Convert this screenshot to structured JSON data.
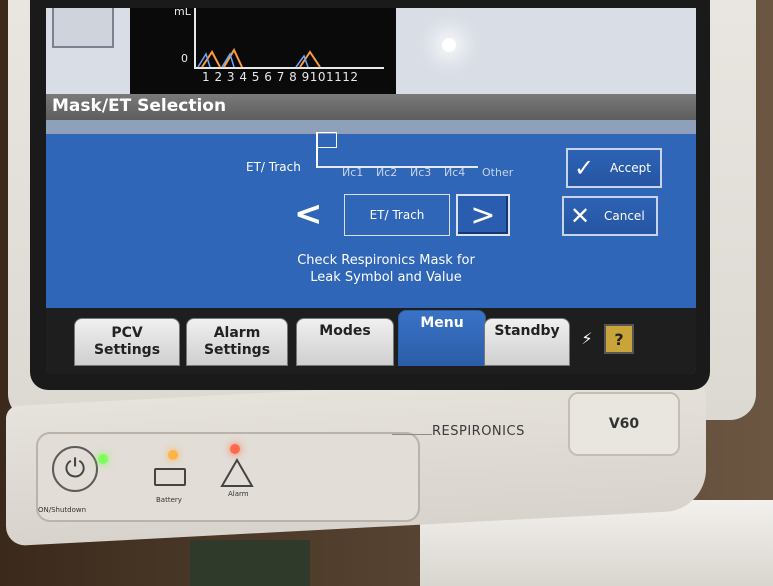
{
  "graph": {
    "unit": "mL",
    "zero": "0",
    "ticks": "1 2 3 4 5 6 7 8 9101112"
  },
  "dialog": {
    "title": "Mask/ET Selection",
    "scale": {
      "start_label": "ET/ Trach",
      "marks": [
        "Ис1",
        "Ис2",
        "Ис3",
        "Ис4"
      ],
      "end_label": "Other"
    },
    "nav_left": "<",
    "nav_right": ">",
    "current_value": "ET/ Trach",
    "message_line1": "Check Respironics Mask for",
    "message_line2": "Leak Symbol and Value",
    "accept_label": "Accept",
    "cancel_label": "Cancel"
  },
  "tabs": [
    {
      "line1": "PCV",
      "line2": "Settings"
    },
    {
      "line1": "Alarm",
      "line2": "Settings"
    },
    {
      "line1": "Modes",
      "line2": ""
    },
    {
      "line1": "Menu",
      "line2": ""
    },
    {
      "line1": "Standby",
      "line2": ""
    }
  ],
  "help_label": "?",
  "hardware": {
    "power_label": "ON/Shutdown",
    "battery_label": "Battery",
    "alarm_label": "Alarm",
    "brand": "RESPIRONICS",
    "model": "V60"
  },
  "colors": {
    "screen_blue": "#2f66b8",
    "led_green": "#7dff5a",
    "led_orange": "#ffb347",
    "led_red": "#ff6a4a"
  },
  "icons": [
    "power-icon",
    "battery-icon",
    "alarm-triangle-icon",
    "plug-icon",
    "check-icon",
    "x-icon",
    "help-icon"
  ]
}
